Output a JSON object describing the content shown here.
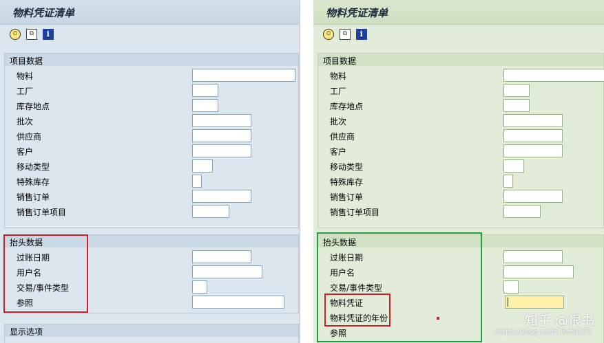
{
  "left": {
    "title": "物料凭证清单",
    "toolbar": [
      "clock-execute-icon",
      "multiple-selection-icon",
      "info-icon"
    ],
    "item_group": {
      "title": "项目数据",
      "fields": [
        "物料",
        "工厂",
        "库存地点",
        "批次",
        "供应商",
        "客户",
        "移动类型",
        "特殊库存",
        "销售订单",
        "销售订单项目"
      ]
    },
    "header_group": {
      "title": "抬头数据",
      "fields": [
        "过账日期",
        "用户名",
        "交易/事件类型",
        "参照"
      ]
    },
    "display_group": {
      "title": "显示选项"
    }
  },
  "right": {
    "title": "物料凭证清单",
    "toolbar": [
      "clock-execute-icon",
      "multiple-selection-icon",
      "info-icon"
    ],
    "item_group": {
      "title": "项目数据",
      "fields": [
        "物料",
        "工厂",
        "库存地点",
        "批次",
        "供应商",
        "客户",
        "移动类型",
        "特殊库存",
        "销售订单",
        "销售订单项目"
      ]
    },
    "header_group": {
      "title": "抬头数据",
      "fields": [
        "过账日期",
        "用户名",
        "交易/事件类型",
        "物料凭证",
        "物料凭证的年份",
        "参照"
      ]
    }
  },
  "watermark": {
    "text": "知乎 @恨书",
    "url": "https://blog.csdn.net/jc63"
  },
  "colors": {
    "highlight_red": "#d11f2a",
    "highlight_green": "#1aa33a",
    "focused_field": "#fff2a8"
  }
}
